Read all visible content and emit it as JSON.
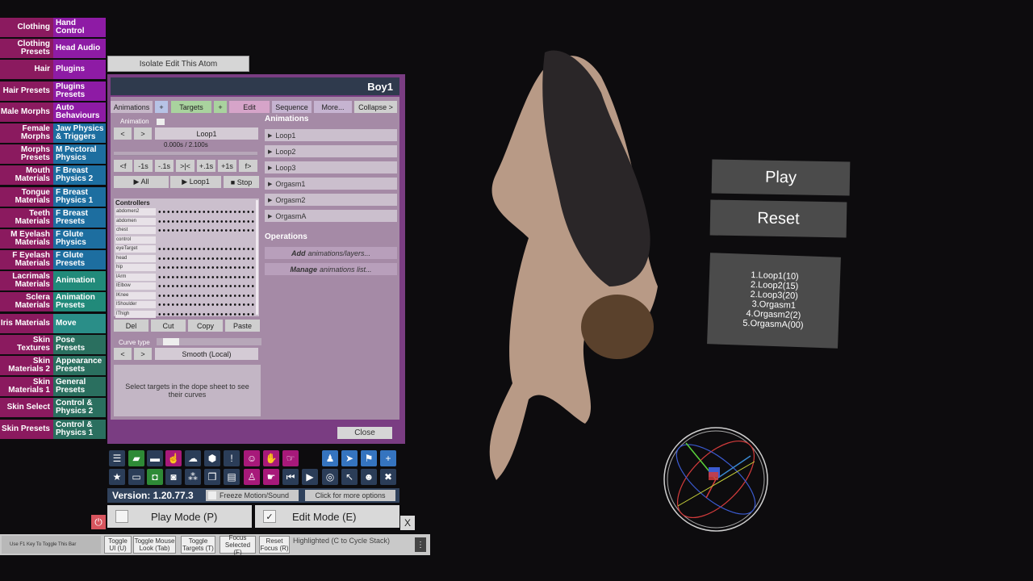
{
  "left_column": [
    "Clothing",
    "Clothing Presets",
    "Hair",
    "Hair Presets",
    "Male Morphs",
    "Female Morphs",
    "Morphs Presets",
    "Mouth Materials",
    "Tongue Materials",
    "Teeth Materials",
    "M Eyelash Materials",
    "F Eyelash Materials",
    "Lacrimals Materials",
    "Sclera Materials",
    "Iris Materials",
    "Skin Textures",
    "Skin Materials 2",
    "Skin Materials 1",
    "Skin Select",
    "Skin Presets"
  ],
  "right_column": [
    "Hand Control",
    "Head Audio",
    "Plugins",
    "Plugins Presets",
    "Auto Behaviours",
    "Jaw Physics & Triggers",
    "M Pectoral Physics",
    "F Breast Physics 2",
    "F Breast Physics 1",
    "F Breast Presets",
    "F Glute Physics",
    "F Glute Presets",
    "Animation",
    "Animation Presets",
    "Move",
    "Pose Presets",
    "Appearance Presets",
    "General Presets",
    "Control & Physics 2",
    "Control & Physics 1"
  ],
  "isolate_button": "Isolate Edit This Atom",
  "panel": {
    "title": "Boy1",
    "tabs": {
      "animations": "Animations",
      "plus1": "+",
      "targets": "Targets",
      "plus2": "+",
      "edit": "Edit",
      "sequence": "Sequence",
      "more": "More...",
      "collapse": "Collapse >"
    },
    "animation_label": "Animation",
    "prev": "<",
    "next": ">",
    "current_animation": "Loop1",
    "time": "0.000s / 2.100s",
    "scrub_buttons": [
      "<f",
      "-1s",
      "-.1s",
      ">|<",
      "+.1s",
      "+1s",
      "f>"
    ],
    "play_all": "▶ All",
    "play_loop": "▶ Loop1",
    "stop": "■ Stop",
    "controllers_label": "Controllers",
    "controllers": [
      "abdomen2",
      "abdomen",
      "chest",
      "control",
      "eyeTarget",
      "head",
      "hip",
      "lArm",
      "lElbow",
      "lKnee",
      "lShoulder",
      "lThigh"
    ],
    "edit_buttons": [
      "Del",
      "Cut",
      "Copy",
      "Paste"
    ],
    "curve_type_label": "Curve type",
    "curve_type": "Smooth (Local)",
    "description": "Select targets in the dope sheet to see their curves",
    "animations_header": "Animations",
    "animations": [
      "Loop1",
      "Loop2",
      "Loop3",
      "Orgasm1",
      "Orgasm2",
      "OrgasmA"
    ],
    "operations_header": "Operations",
    "op_add_bold": "Add",
    "op_add_rest": "animations/layers...",
    "op_manage_bold": "Manage",
    "op_manage_rest": "animations list...",
    "close": "Close"
  },
  "version": "Version: 1.20.77.3",
  "freeze": "Freeze Motion/Sound",
  "more_options": "Click for more options",
  "play_mode": "Play Mode (P)",
  "edit_mode": "Edit Mode (E)",
  "edit_mode_check": "✓",
  "close_x": "X",
  "power": "⏻",
  "bottom": {
    "hint": "Use F1 Key To Toggle This Bar",
    "toggle_ui": "Toggle UI (U)",
    "toggle_mouse": "Toggle Mouse Look (Tab)",
    "toggle_targets": "Toggle Targets (T)",
    "focus_selected": "Focus Selected (F)",
    "reset_focus": "Reset Focus (R)",
    "highlighted": "Highlighted (C to Cycle Stack)",
    "menu": "⋮"
  },
  "scene_panels": {
    "play": "Play",
    "reset": "Reset",
    "list": [
      "1.Loop1(10)",
      "2.Loop2(15)",
      "2.Loop3(20)",
      "3.Orgasm1",
      "4.Orgasm2(2)",
      "5.OrgasmA(00)"
    ]
  },
  "toolbar_icons": [
    "menu-icon",
    "green-folder-icon",
    "folder-icon",
    "pointer-pink-icon",
    "cloud-upload-icon",
    "cube-icon",
    "alert-icon",
    "person-pink-icon",
    "hand-icon",
    "hand-point-icon",
    "person-blue-icon",
    "send-icon",
    "flag-icon",
    "plus-icon",
    "star-icon",
    "open-folder-icon",
    "camera-green-icon",
    "camera-icon",
    "nodes-icon",
    "box-open-icon",
    "document-icon",
    "person-plus-icon",
    "pointer-hand-icon",
    "skip-back-icon",
    "play-icon",
    "target-icon",
    "cursor-icon",
    "people-icon",
    "tools-icon"
  ]
}
